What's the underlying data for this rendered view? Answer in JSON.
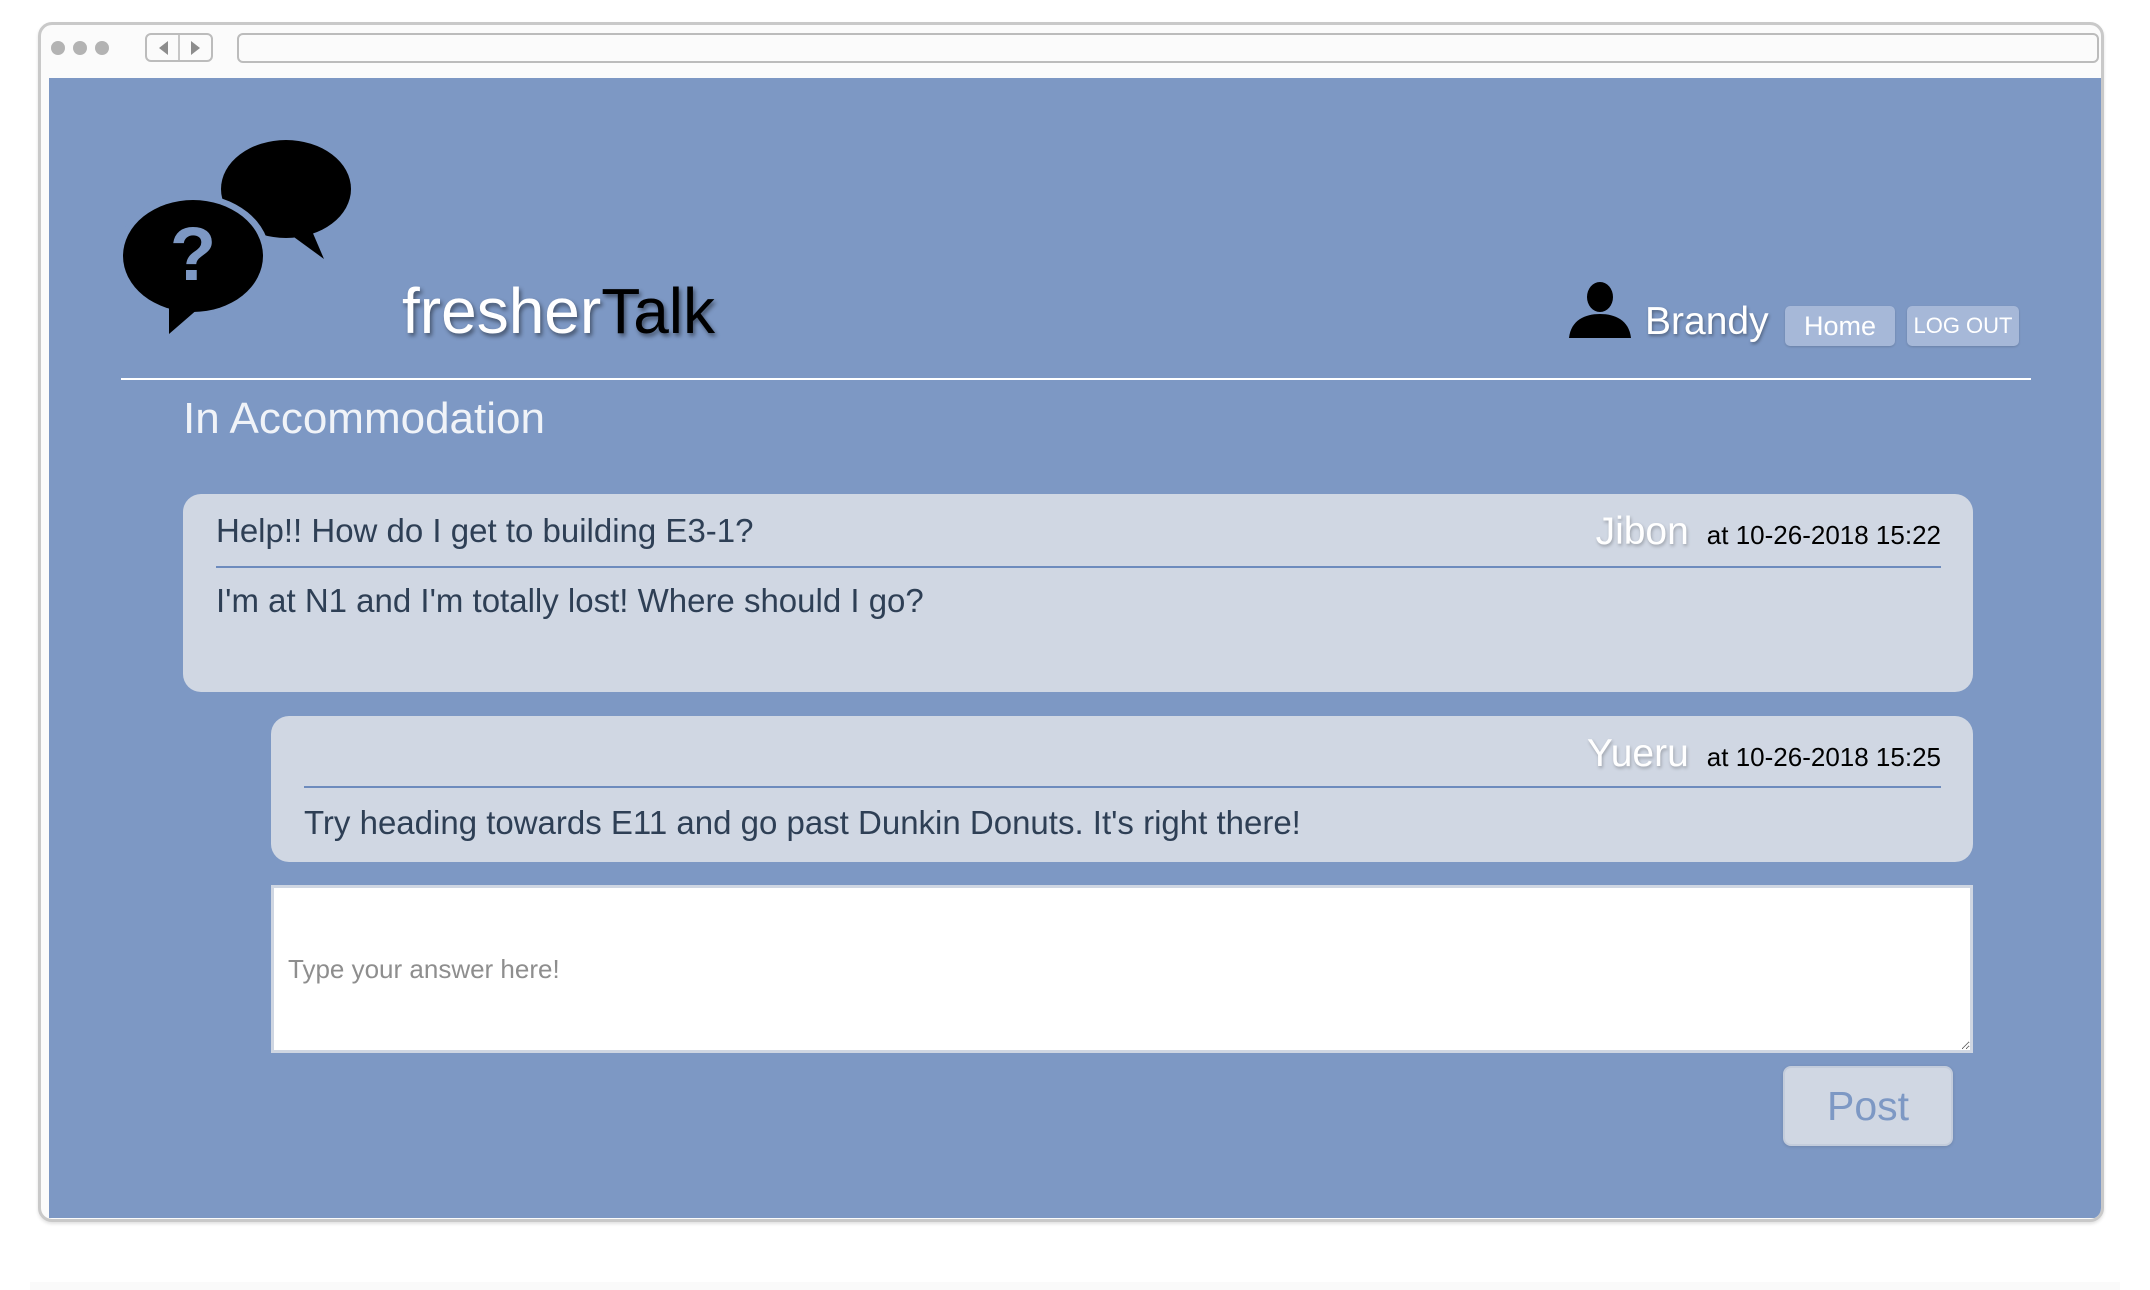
{
  "app": {
    "brand_light": "fresher",
    "brand_dark": "Talk",
    "logo_icon": "question-chat-bubbles-icon"
  },
  "user": {
    "name": "Brandy",
    "icon": "person-icon"
  },
  "nav": {
    "home_label": "Home",
    "logout_label": "LOG OUT"
  },
  "section": {
    "title": "In Accommodation"
  },
  "question": {
    "title": "Help!! How do I get to building E3-1?",
    "author": "Jibon",
    "timestamp": "at 10-26-2018 15:22",
    "body": "I'm at N1 and I'm totally lost! Where should I go?"
  },
  "answers": [
    {
      "author": "Yueru",
      "timestamp": "at 10-26-2018 15:25",
      "body": "Try heading towards E11 and go past Dunkin Donuts. It's right there!"
    }
  ],
  "reply": {
    "placeholder": "Type your answer here!",
    "value": "",
    "post_label": "Post"
  },
  "colors": {
    "background": "#7d98c4",
    "card": "#d0d7e3",
    "accent_rule": "#6d8bbd"
  }
}
